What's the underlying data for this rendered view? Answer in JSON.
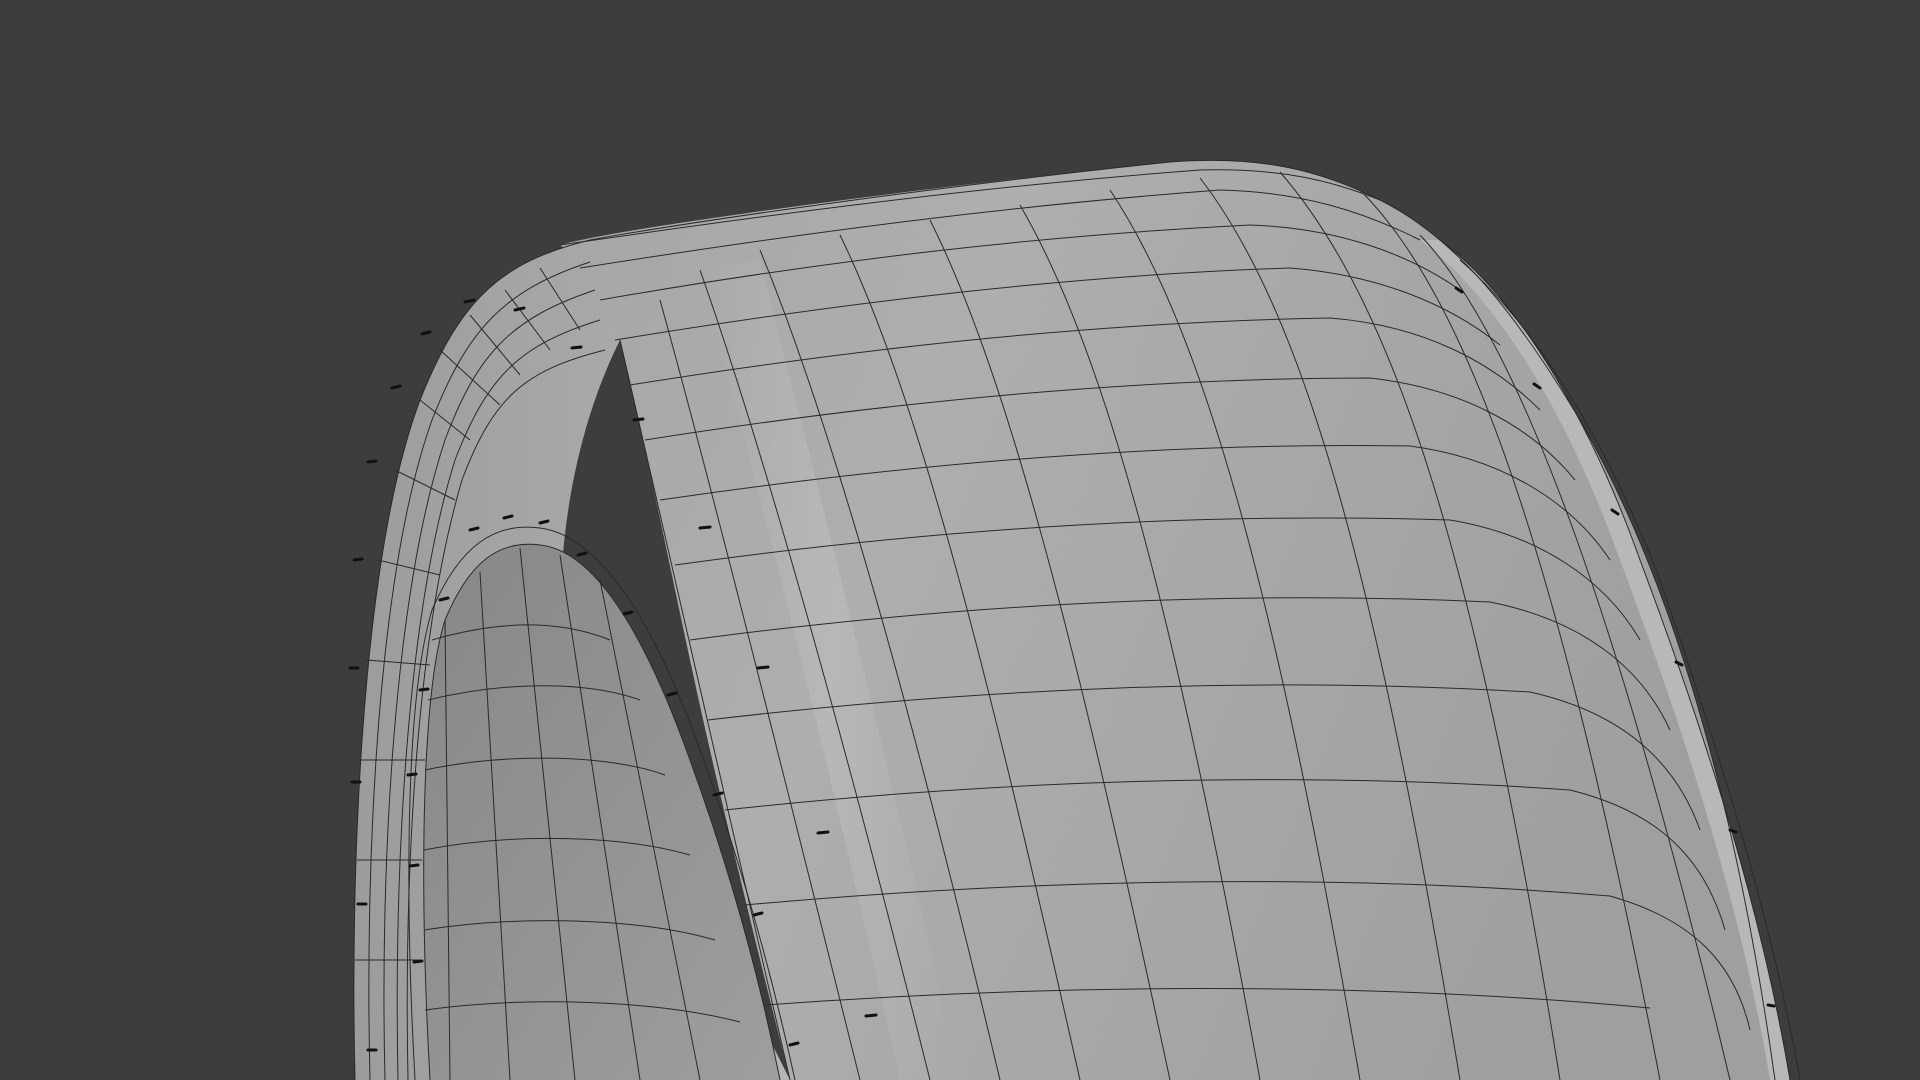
{
  "viewport": {
    "background_color": "#3d3d3d",
    "shading": "solid",
    "overlay": "wireframe"
  },
  "object": {
    "kind": "tire-mesh",
    "surface_color": "#a9abad",
    "wire_color": "#2a2a2a",
    "crease_mark_color": "#111111"
  }
}
